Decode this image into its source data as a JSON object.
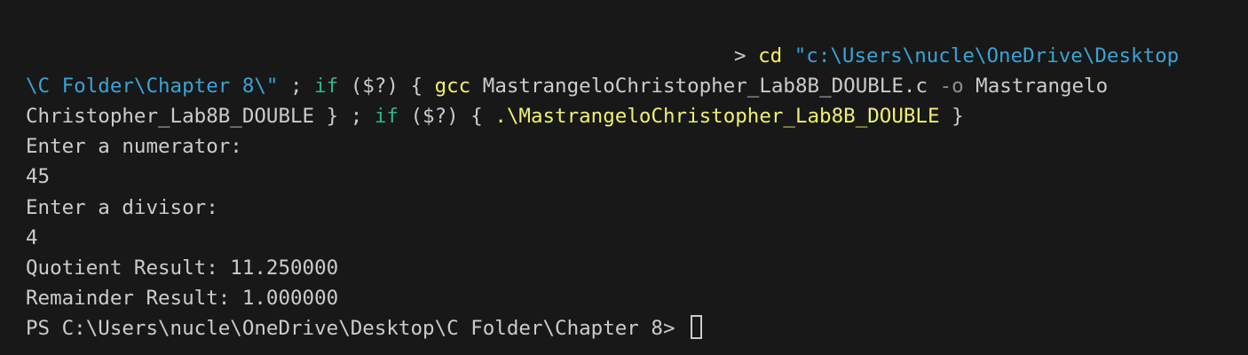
{
  "command": {
    "prompt_glyph": ">",
    "cd": "cd",
    "path_part1": "\"c:\\Users\\nucle\\OneDrive\\Desktop",
    "path_part2": "\\C Folder\\Chapter 8\\\"",
    "sep1": " ; ",
    "if1": "if",
    "cond1": " ($?) ",
    "brace_open1": "{ ",
    "gcc": "gcc",
    "source_file": " MastrangeloChristopher_Lab8B_DOUBLE.c ",
    "flag_o": "-o",
    "output_part1": " Mastrangelo",
    "output_part2": "Christopher_Lab8B_DOUBLE",
    "brace_close1": " }",
    "sep2": " ; ",
    "if2": "if",
    "cond2": " ($?) ",
    "brace_open2": "{ ",
    "run_exe": ".\\MastrangeloChristopher_Lab8B_DOUBLE",
    "brace_close2": " }"
  },
  "output": [
    "Enter a numerator:",
    "45",
    "Enter a divisor:",
    "4",
    "Quotient Result: 11.250000",
    "Remainder Result: 1.000000"
  ],
  "prompt": "PS C:\\Users\\nucle\\OneDrive\\Desktop\\C Folder\\Chapter 8> ",
  "colors": {
    "background": "#181818",
    "text": "#cccccc",
    "command": "#f0f06e",
    "string": "#38a4d6",
    "keyword": "#2fb88f",
    "flag": "#8e8e8e"
  }
}
